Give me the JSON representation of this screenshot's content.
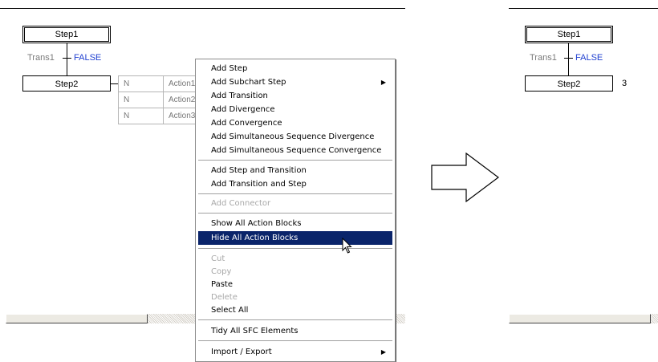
{
  "left_pane": {
    "step1_label": "Step1",
    "trans_label": "Trans1",
    "trans_condition": "FALSE",
    "step2_label": "Step2",
    "actions": [
      {
        "qualifier": "N",
        "name": "Action1"
      },
      {
        "qualifier": "N",
        "name": "Action2"
      },
      {
        "qualifier": "N",
        "name": "Action3"
      }
    ]
  },
  "context_menu": {
    "items": [
      {
        "label": "Add Step",
        "enabled": true,
        "submenu": false
      },
      {
        "label": "Add Subchart Step",
        "enabled": true,
        "submenu": true
      },
      {
        "label": "Add Transition",
        "enabled": true,
        "submenu": false
      },
      {
        "label": "Add Divergence",
        "enabled": true,
        "submenu": false
      },
      {
        "label": "Add Convergence",
        "enabled": true,
        "submenu": false
      },
      {
        "label": "Add Simultaneous Sequence Divergence",
        "enabled": true,
        "submenu": false
      },
      {
        "label": "Add Simultaneous Sequence Convergence",
        "enabled": true,
        "submenu": false
      },
      {
        "label": "Add Step and Transition",
        "enabled": true,
        "submenu": false
      },
      {
        "label": "Add Transition and Step",
        "enabled": true,
        "submenu": false
      },
      {
        "label": "Add Connector",
        "enabled": false,
        "submenu": false
      },
      {
        "label": "Show All Action Blocks",
        "enabled": true,
        "submenu": false
      },
      {
        "label": "Hide All Action Blocks",
        "enabled": true,
        "submenu": false,
        "highlighted": true
      },
      {
        "label": "Cut",
        "enabled": false,
        "submenu": false
      },
      {
        "label": "Copy",
        "enabled": false,
        "submenu": false
      },
      {
        "label": "Paste",
        "enabled": true,
        "submenu": false
      },
      {
        "label": "Delete",
        "enabled": false,
        "submenu": false
      },
      {
        "label": "Select All",
        "enabled": true,
        "submenu": false
      },
      {
        "label": "Tidy All SFC Elements",
        "enabled": true,
        "submenu": false
      },
      {
        "label": "Import / Export",
        "enabled": true,
        "submenu": true
      }
    ]
  },
  "right_pane": {
    "step1_label": "Step1",
    "trans_label": "Trans1",
    "trans_condition": "FALSE",
    "step2_label": "Step2",
    "action_count": "3"
  },
  "icons": {
    "transform_arrow": "right-arrow-outline-icon",
    "cursor": "mouse-pointer-icon",
    "submenu": "submenu-arrow-icon"
  },
  "colors": {
    "menu_highlight": "#0a246a",
    "condition_text": "#1f3fd0",
    "disabled_text": "#a8a8a8"
  }
}
